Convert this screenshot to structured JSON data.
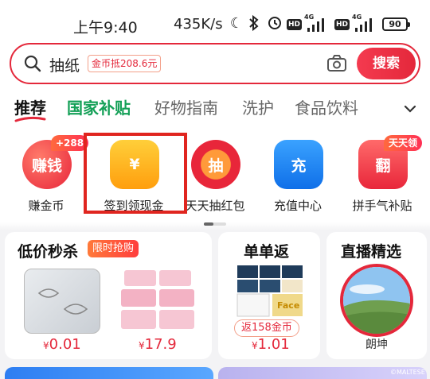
{
  "status": {
    "time": "上午9:40",
    "speed": "435K/s",
    "hd1": "HD",
    "hd2": "HD",
    "net1": "4G",
    "net2": "4G",
    "battery": "90"
  },
  "search": {
    "query": "抽纸",
    "coin_tag": "金币抵208.6元",
    "button": "搜索"
  },
  "tabs": [
    {
      "label": "推荐"
    },
    {
      "label": "国家补贴"
    },
    {
      "label": "好物指南"
    },
    {
      "label": "洗护"
    },
    {
      "label": "食品饮料"
    }
  ],
  "shortcuts": [
    {
      "label": "赚金币",
      "icon_text": "赚钱",
      "badge": "+288",
      "color": "#f0394a"
    },
    {
      "label": "签到领现金",
      "icon_text": "¥",
      "color": "#ffb316"
    },
    {
      "label": "天天抽红包",
      "icon_text": "抽",
      "color": "#f05a3a"
    },
    {
      "label": "充值中心",
      "icon_text": "充",
      "color": "#1f8bf5"
    },
    {
      "label": "拼手气补贴",
      "icon_text": "翻",
      "badge": "天天领",
      "color": "#f23c55"
    }
  ],
  "cards": {
    "flash": {
      "title": "低价秒杀",
      "tag": "限时抢购",
      "items": [
        {
          "currency": "¥",
          "price": "0.01"
        },
        {
          "currency": "¥",
          "price": "17.9"
        }
      ]
    },
    "rebate": {
      "title": "单单返",
      "rebate": "返158金币",
      "currency": "¥",
      "price": "1.01",
      "product_brand": "Face"
    },
    "live": {
      "title": "直播精选",
      "name": "朗坤"
    }
  },
  "watermark": "©MALTESE"
}
